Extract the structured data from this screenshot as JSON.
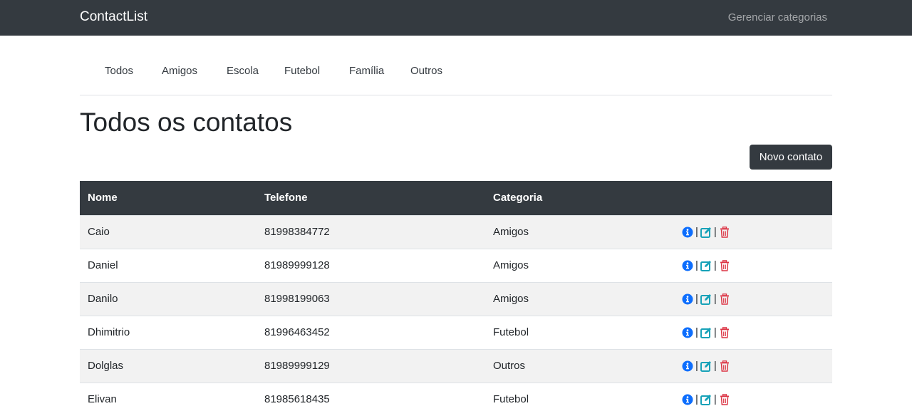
{
  "navbar": {
    "brand": "ContactList",
    "manage_link": "Gerenciar categorias"
  },
  "tabs": [
    {
      "label": "Todos"
    },
    {
      "label": "Amigos"
    },
    {
      "label": "Escola"
    },
    {
      "label": "Futebol"
    },
    {
      "label": "Família"
    },
    {
      "label": "Outros"
    }
  ],
  "main": {
    "title": "Todos os contatos",
    "new_contact_label": "Novo contato"
  },
  "table": {
    "headers": [
      "Nome",
      "Telefone",
      "Categoria",
      ""
    ],
    "separator": "|",
    "rows": [
      {
        "nome": "Caio",
        "telefone": "81998384772",
        "categoria": "Amigos"
      },
      {
        "nome": "Daniel",
        "telefone": "81989999128",
        "categoria": "Amigos"
      },
      {
        "nome": "Danilo",
        "telefone": "81998199063",
        "categoria": "Amigos"
      },
      {
        "nome": "Dhimitrio",
        "telefone": "81996463452",
        "categoria": "Futebol"
      },
      {
        "nome": "Dolglas",
        "telefone": "81989999129",
        "categoria": "Outros"
      },
      {
        "nome": "Elivan",
        "telefone": "81985618435",
        "categoria": "Futebol"
      }
    ],
    "action_icons": [
      "info-icon",
      "edit-icon",
      "trash-icon"
    ]
  },
  "colors": {
    "navbar_bg": "#343a40",
    "info": "#0d6efd",
    "edit": "#17a2b8",
    "delete": "#dc3545",
    "stripe": "#f2f2f2"
  }
}
